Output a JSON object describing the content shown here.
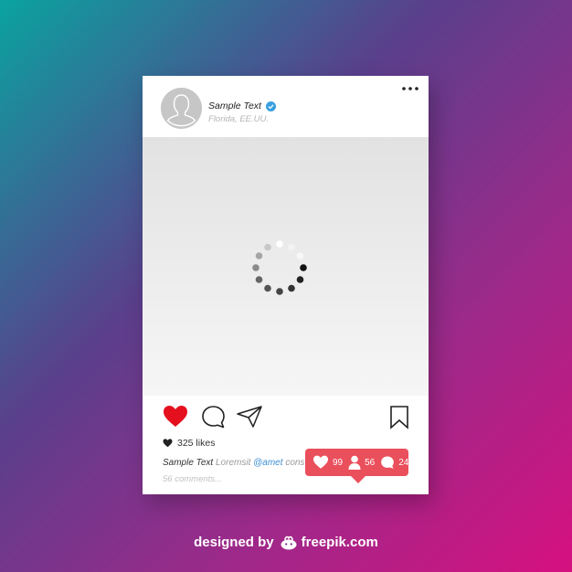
{
  "post": {
    "username": "Sample Text",
    "location": "Florida, EE.UU.",
    "likes": "325 likes",
    "caption_user": "Sample Text",
    "caption_text": "Loremsit",
    "caption_mention": "@amet",
    "caption_rest": "cons",
    "comments": "56 comments..."
  },
  "notification": {
    "likes": "99",
    "followers": "56",
    "comments": "24"
  },
  "credit": {
    "prefix": "designed by",
    "brand": "freepik.com"
  },
  "colors": {
    "like_red": "#e5101e",
    "notification_bg": "#ea4f5c",
    "verified_blue": "#3aa0e0",
    "mention_blue": "#3b8fd6"
  },
  "icons": {
    "like": "heart-icon",
    "comment": "comment-bubble-icon",
    "share": "paper-plane-icon",
    "save": "bookmark-icon",
    "more": "more-dots-icon",
    "verified": "verified-badge-icon",
    "loading": "loading-spinner-icon"
  }
}
